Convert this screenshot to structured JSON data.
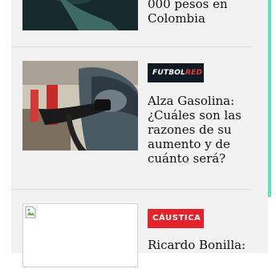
{
  "articles": [
    {
      "headline_partial": "000 pesos en\nColombia"
    },
    {
      "source": "FUTBOLRED",
      "source_part1": "FUTBOL",
      "source_part2": "RED",
      "headline": "Alza Gasolina: ¿Cuáles son las razones de su aumento y de cuánto será?"
    },
    {
      "source": "CÁUSTICA",
      "headline": "Ricardo Bonilla:"
    }
  ],
  "colors": {
    "accent": "#5fe0c8",
    "futbolred_badge": "#0f1a22",
    "caustica_badge": "#e3222b"
  }
}
